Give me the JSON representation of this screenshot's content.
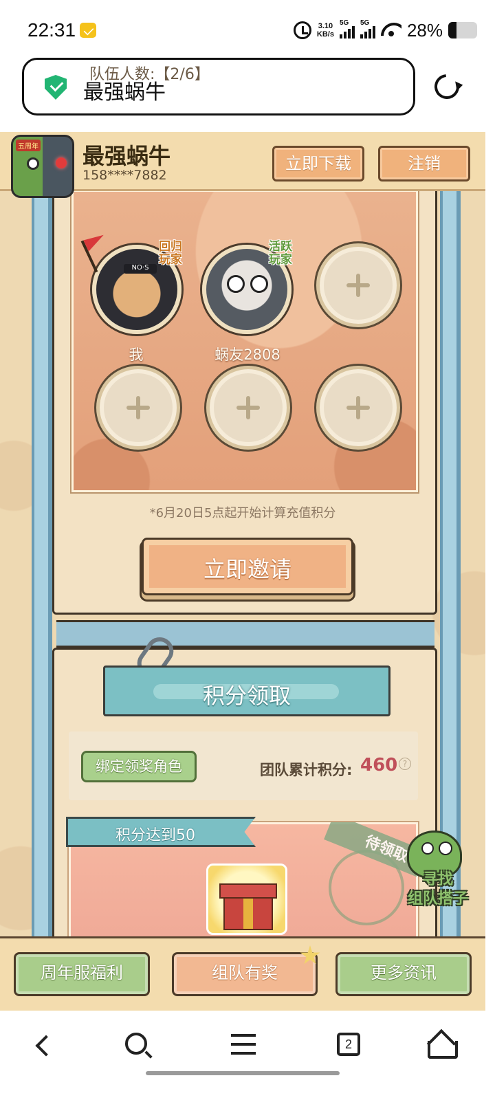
{
  "status_bar": {
    "time": "22:31",
    "net_speed_value": "3.10",
    "net_speed_unit": "KB/s",
    "sim1": "5G",
    "sim2": "5G",
    "battery_percent": "28%",
    "battery_level": 0.28,
    "icons": [
      "mail-notification-icon",
      "alarm-icon",
      "signal-icon",
      "wifi-icon",
      "battery-icon"
    ]
  },
  "browser": {
    "url_text": "最强蜗牛",
    "icons": [
      "secure-shield-icon",
      "reload-icon"
    ]
  },
  "header": {
    "app_name": "最强蜗牛",
    "app_badge": "五周年",
    "phone": "158****7882",
    "download_label": "立即下载",
    "logout_label": "注销"
  },
  "team": {
    "count_label": "队伍人数:【2/6】",
    "members": [
      {
        "name": "我",
        "tag": "回归玩家"
      },
      {
        "name": "蜗友2808",
        "tag": "活跃玩家"
      }
    ],
    "avatar_text": "NO·S",
    "empty_slot_icon": "plus-icon"
  },
  "note": "*6月20日5点起开始计算充值积分",
  "invite_label": "立即邀请",
  "points": {
    "banner": "积分领取",
    "bind_label": "绑定领奖角色",
    "team_points_label": "团队累计积分:",
    "team_points_value": "460",
    "help": "?"
  },
  "reward": {
    "ribbon": "积分达到50",
    "stamp": "待领取",
    "finder_label": "寻找组队搭子"
  },
  "game_nav": {
    "items": [
      "周年服福利",
      "组队有奖",
      "更多资讯"
    ],
    "active_index": 1
  },
  "system_nav": {
    "tab_count": "2",
    "icons": [
      "back-icon",
      "search-icon",
      "menu-icon",
      "tabs-icon",
      "home-icon"
    ]
  },
  "colors": {
    "accent_orange": "#f0b27c",
    "accent_teal": "#7cc0c4",
    "accent_green": "#a9cd8b",
    "points_value": "#c0505a",
    "secure_green": "#22b573"
  }
}
